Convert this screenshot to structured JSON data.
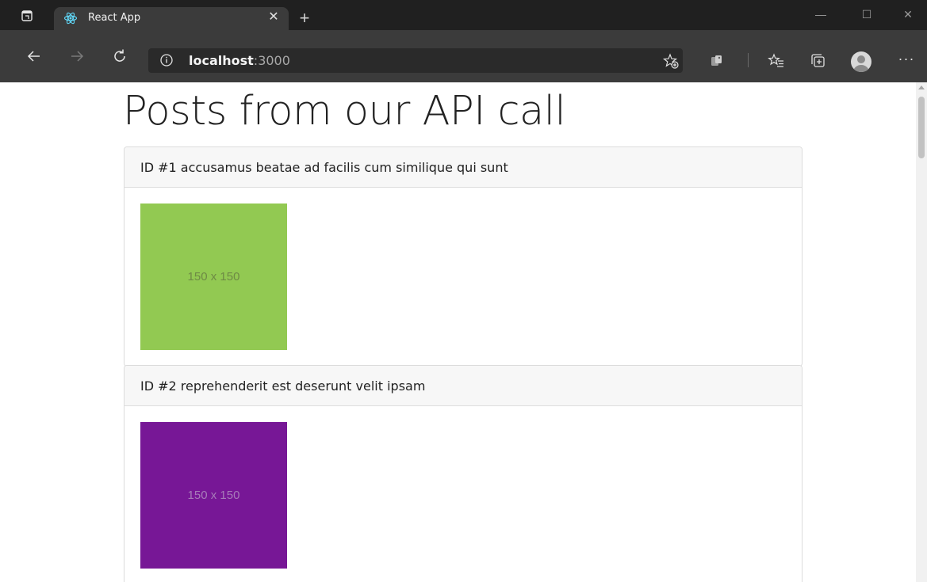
{
  "browser": {
    "tab_title": "React App",
    "address": {
      "host": "localhost",
      "port": ":3000"
    }
  },
  "page": {
    "title": "Posts from our API call",
    "posts": [
      {
        "header": "ID #1 accusamus beatae ad facilis cum similique qui sunt",
        "thumbnail": {
          "label": "150 x 150",
          "color": "#92c952",
          "text_color": "#6e8a45"
        }
      },
      {
        "header": "ID #2 reprehenderit est deserunt velit ipsam",
        "thumbnail": {
          "label": "150 x 150",
          "color": "#771796",
          "text_color": "#a77bb9"
        }
      }
    ]
  },
  "icons": {
    "tab_actions": "tab-actions-icon",
    "favicon": "react-logo-icon",
    "close": "close-icon",
    "new_tab": "plus-icon",
    "back": "arrow-left-icon",
    "forward": "arrow-right-icon",
    "refresh": "refresh-icon",
    "info": "info-icon",
    "add_favorite": "star-plus-icon",
    "extension": "extension-icon",
    "favorites": "favorites-list-icon",
    "collections": "collections-icon",
    "profile": "avatar-icon",
    "more": "more-icon"
  }
}
